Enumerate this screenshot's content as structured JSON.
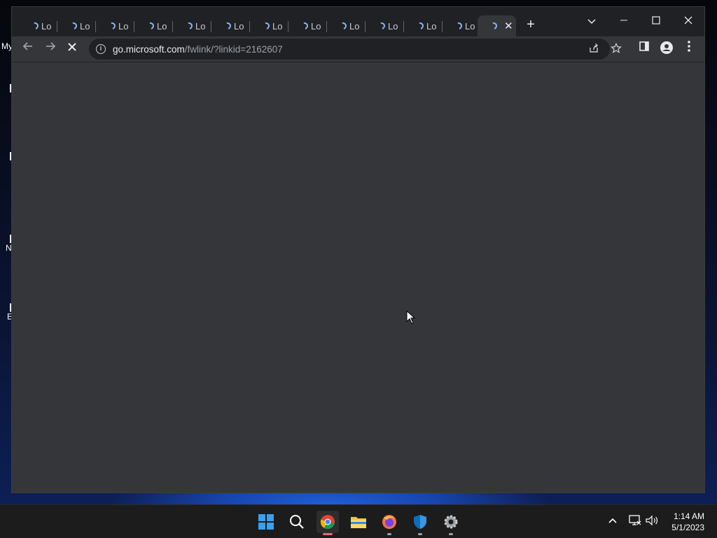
{
  "desktop": {
    "label_my": "My",
    "icon_labels": [
      "N",
      "E"
    ]
  },
  "browser": {
    "tabs": [
      {
        "label": "Lo"
      },
      {
        "label": "Lo"
      },
      {
        "label": "Lo"
      },
      {
        "label": "Lo"
      },
      {
        "label": "Lo"
      },
      {
        "label": "Lo"
      },
      {
        "label": "Lo"
      },
      {
        "label": "Lo"
      },
      {
        "label": "Lo"
      },
      {
        "label": "Lo"
      },
      {
        "label": "Lo"
      },
      {
        "label": "Lo"
      },
      {
        "label": ""
      }
    ],
    "close_glyph": "✕",
    "new_tab_glyph": "+",
    "omnibox": {
      "host": "go.microsoft.com",
      "path": "/fwlink/?linkid=2162607"
    }
  },
  "taskbar": {
    "apps": [
      "start-icon",
      "search-icon",
      "chrome-icon",
      "file-explorer-icon",
      "firefox-icon",
      "defender-icon",
      "settings-icon"
    ],
    "clock_time": "1:14 AM",
    "clock_date": "5/1/2023"
  },
  "colors": {
    "content_bg": "#35363a",
    "tabstrip_bg": "#202124",
    "spinner": "#8ab4f8"
  }
}
